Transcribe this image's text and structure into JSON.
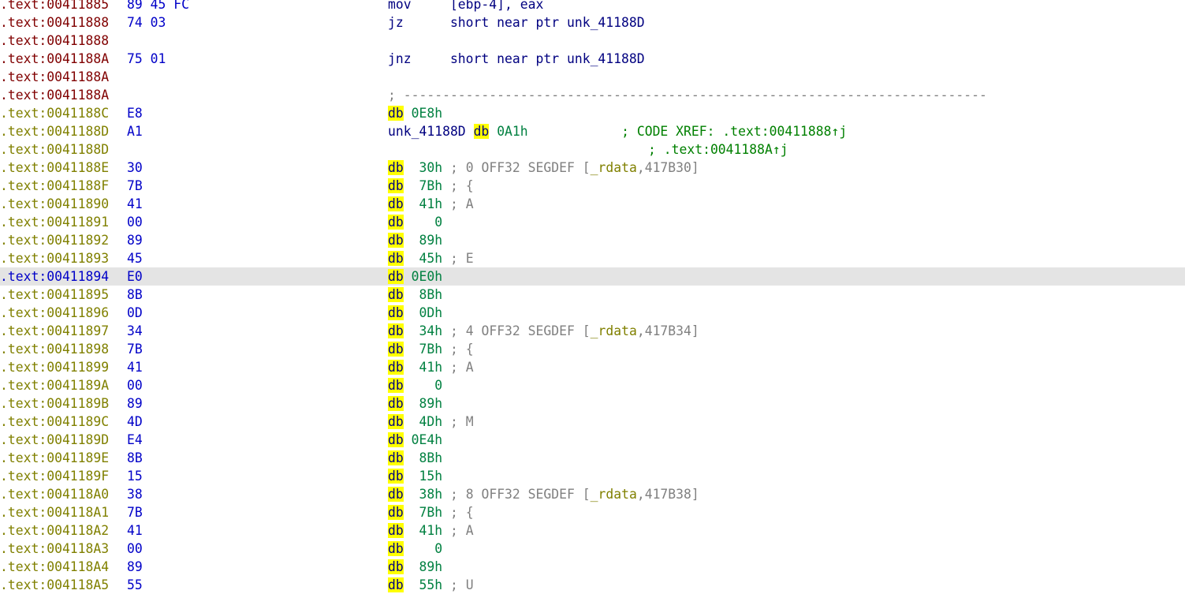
{
  "colors": {
    "red_address": "#800000",
    "olive_address": "#808000",
    "blue_address": "#0000c8",
    "highlight_row": "#e4e4e4",
    "db_keyword_bg": "#ffff00"
  },
  "lines": [
    {
      "addr": ".text:00411885",
      "bytes": "89 45 FC",
      "text": "mov     [ebp-4], eax",
      "style": "red"
    },
    {
      "addr": ".text:00411888",
      "bytes": "74 03",
      "text": "jz      short near ptr unk_41188D",
      "style": "red"
    },
    {
      "addr": ".text:00411888",
      "bytes": "",
      "text": "",
      "style": "red"
    },
    {
      "addr": ".text:0041188A",
      "bytes": "75 01",
      "text": "jnz     short near ptr unk_41188D",
      "style": "red"
    },
    {
      "addr": ".text:0041188A",
      "bytes": "",
      "text": "",
      "style": "red"
    },
    {
      "addr": ".text:0041188A",
      "bytes": "",
      "text": "; ---------------------------------------------------------------------------",
      "style": "red",
      "kind": "sep"
    },
    {
      "addr": ".text:0041188C",
      "bytes": "E8",
      "kw": "db",
      "val": "0E8h",
      "style": "olive"
    },
    {
      "addr": ".text:0041188D",
      "bytes": "A1",
      "label": "unk_41188D",
      "kw": "db",
      "val": "0A1h",
      "xref": "; CODE XREF: .text:00411888↑j",
      "style": "olive"
    },
    {
      "addr": ".text:0041188D",
      "bytes": "",
      "xref_cont": "; .text:0041188A↑j",
      "style": "olive"
    },
    {
      "addr": ".text:0041188E",
      "bytes": "30",
      "kw": "db",
      "val": " 30h",
      "cmt": "; 0 OFF32 SEGDEF [",
      "seg": "_rdata",
      "cmt2": ",417B30]",
      "style": "olive"
    },
    {
      "addr": ".text:0041188F",
      "bytes": "7B",
      "kw": "db",
      "val": " 7Bh",
      "cmt": "; {",
      "style": "olive"
    },
    {
      "addr": ".text:00411890",
      "bytes": "41",
      "kw": "db",
      "val": " 41h",
      "cmt": "; A",
      "style": "olive"
    },
    {
      "addr": ".text:00411891",
      "bytes": "00",
      "kw": "db",
      "val": "   0",
      "style": "olive"
    },
    {
      "addr": ".text:00411892",
      "bytes": "89",
      "kw": "db",
      "val": " 89h",
      "style": "olive"
    },
    {
      "addr": ".text:00411893",
      "bytes": "45",
      "kw": "db",
      "val": " 45h",
      "cmt": "; E",
      "style": "olive"
    },
    {
      "addr": ".text:00411894",
      "bytes": "E0",
      "kw": "db",
      "val": "0E0h",
      "style": "blue",
      "selected": true
    },
    {
      "addr": ".text:00411895",
      "bytes": "8B",
      "kw": "db",
      "val": " 8Bh",
      "style": "olive"
    },
    {
      "addr": ".text:00411896",
      "bytes": "0D",
      "kw": "db",
      "val": " 0Dh",
      "style": "olive"
    },
    {
      "addr": ".text:00411897",
      "bytes": "34",
      "kw": "db",
      "val": " 34h",
      "cmt": "; 4 OFF32 SEGDEF [",
      "seg": "_rdata",
      "cmt2": ",417B34]",
      "style": "olive"
    },
    {
      "addr": ".text:00411898",
      "bytes": "7B",
      "kw": "db",
      "val": " 7Bh",
      "cmt": "; {",
      "style": "olive"
    },
    {
      "addr": ".text:00411899",
      "bytes": "41",
      "kw": "db",
      "val": " 41h",
      "cmt": "; A",
      "style": "olive"
    },
    {
      "addr": ".text:0041189A",
      "bytes": "00",
      "kw": "db",
      "val": "   0",
      "style": "olive"
    },
    {
      "addr": ".text:0041189B",
      "bytes": "89",
      "kw": "db",
      "val": " 89h",
      "style": "olive"
    },
    {
      "addr": ".text:0041189C",
      "bytes": "4D",
      "kw": "db",
      "val": " 4Dh",
      "cmt": "; M",
      "style": "olive"
    },
    {
      "addr": ".text:0041189D",
      "bytes": "E4",
      "kw": "db",
      "val": "0E4h",
      "style": "olive"
    },
    {
      "addr": ".text:0041189E",
      "bytes": "8B",
      "kw": "db",
      "val": " 8Bh",
      "style": "olive"
    },
    {
      "addr": ".text:0041189F",
      "bytes": "15",
      "kw": "db",
      "val": " 15h",
      "style": "olive"
    },
    {
      "addr": ".text:004118A0",
      "bytes": "38",
      "kw": "db",
      "val": " 38h",
      "cmt": "; 8 OFF32 SEGDEF [",
      "seg": "_rdata",
      "cmt2": ",417B38]",
      "style": "olive"
    },
    {
      "addr": ".text:004118A1",
      "bytes": "7B",
      "kw": "db",
      "val": " 7Bh",
      "cmt": "; {",
      "style": "olive"
    },
    {
      "addr": ".text:004118A2",
      "bytes": "41",
      "kw": "db",
      "val": " 41h",
      "cmt": "; A",
      "style": "olive"
    },
    {
      "addr": ".text:004118A3",
      "bytes": "00",
      "kw": "db",
      "val": "   0",
      "style": "olive"
    },
    {
      "addr": ".text:004118A4",
      "bytes": "89",
      "kw": "db",
      "val": " 89h",
      "style": "olive"
    },
    {
      "addr": ".text:004118A5",
      "bytes": "55",
      "kw": "db",
      "val": " 55h",
      "cmt": "; U",
      "style": "olive"
    }
  ]
}
